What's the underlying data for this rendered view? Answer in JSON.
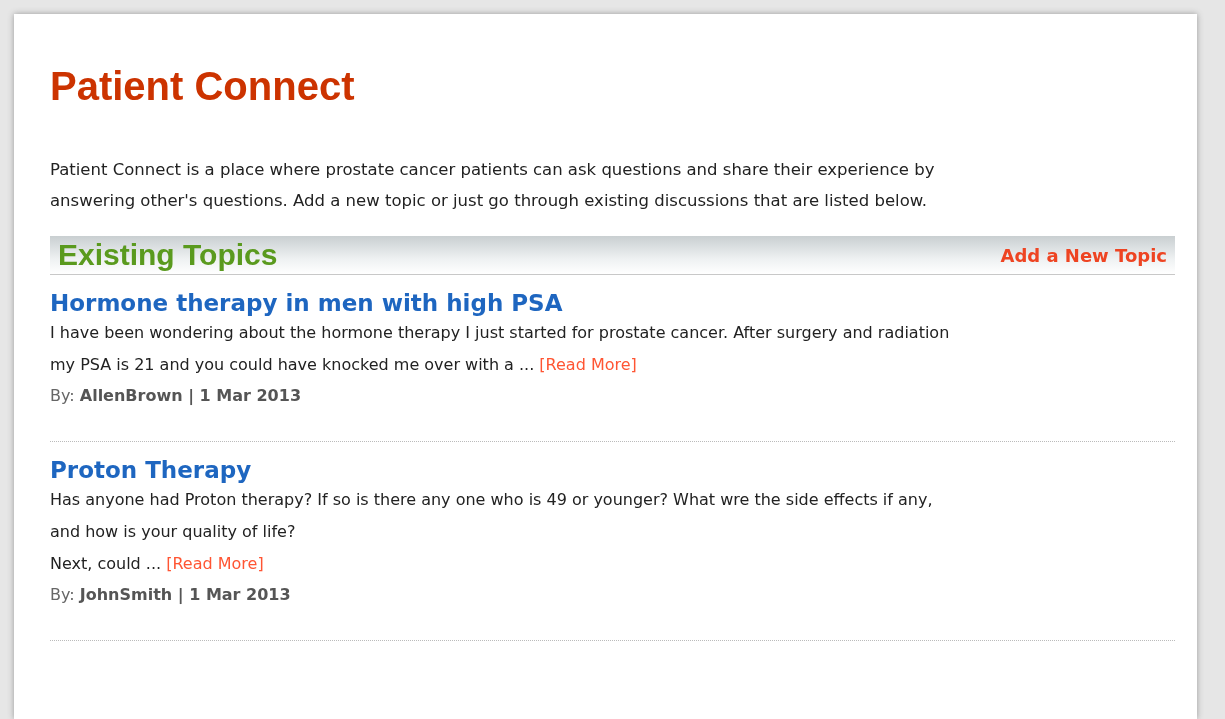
{
  "page": {
    "title": "Patient Connect",
    "intro": "Patient Connect is a place where prostate cancer patients can ask questions and share their experience by\nanswering other's questions. Add a new topic or just go through existing discussions that are listed below."
  },
  "section": {
    "title": "Existing Topics",
    "action": "Add a New Topic"
  },
  "topics": [
    {
      "title": "Hormone therapy in men with high PSA",
      "excerpt": "I have been wondering about the hormone therapy I just started for prostate cancer. After surgery and radiation\nmy PSA is 21 and you could have knocked me over with a ...",
      "read_more": "[Read More]",
      "meta": "By: **AllenBrown | 1 Mar 2013**"
    },
    {
      "title": "Proton Therapy",
      "excerpt": "Has anyone had Proton therapy? If so is there any one who is 49 or younger? What wre the side effects if any,\nand how is your quality of life?\nNext, could ...",
      "read_more": "[Read More]",
      "meta": "By: **JohnSmith | 1 Mar 2013**"
    }
  ]
}
